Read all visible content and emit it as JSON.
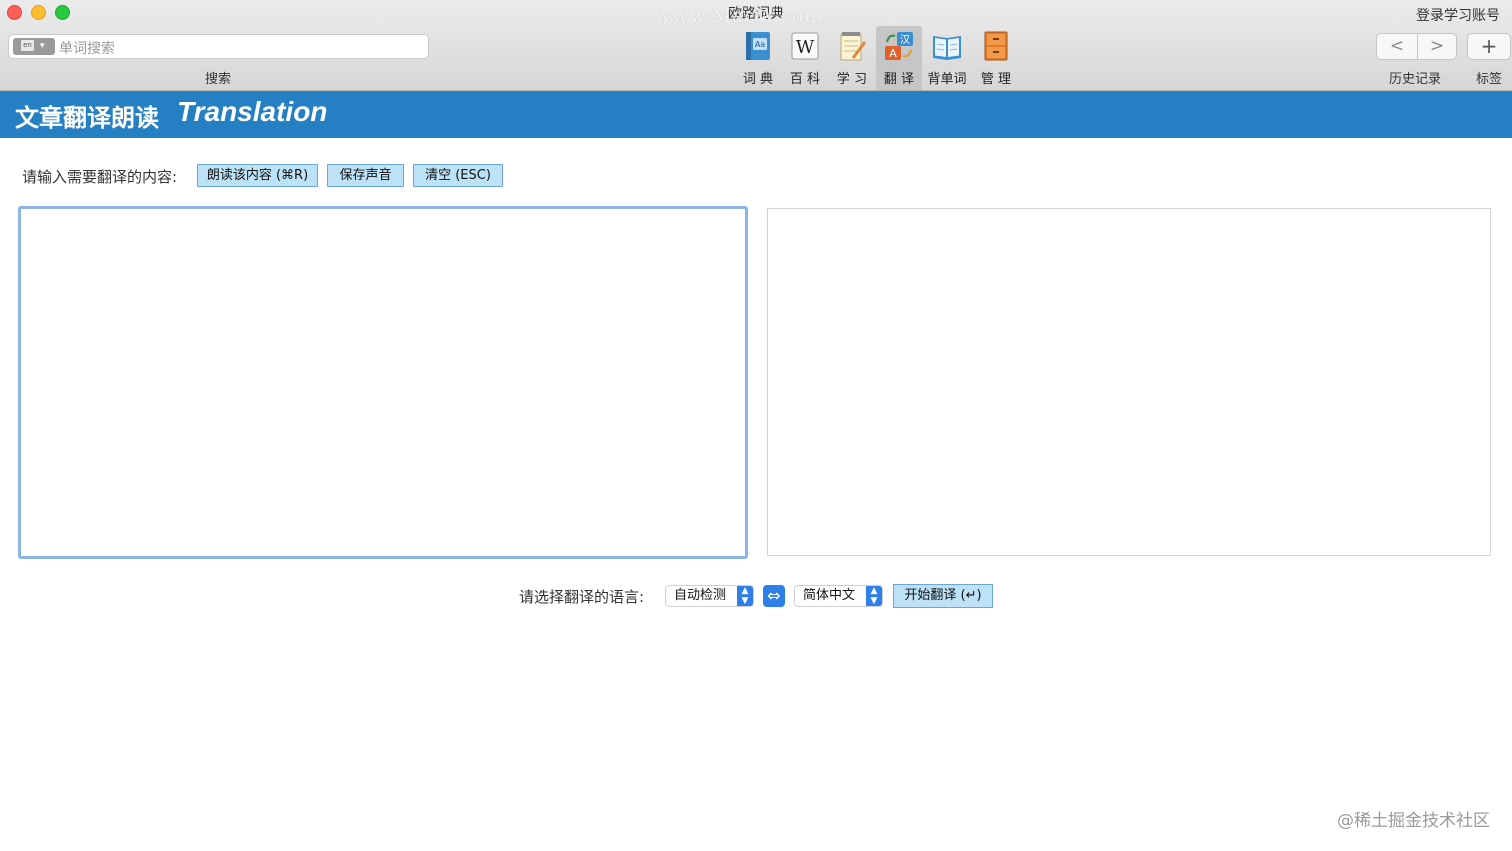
{
  "window": {
    "title": "欧路词典",
    "watermark": "www.MacW.com",
    "login": "登录学习账号"
  },
  "search": {
    "placeholder": "单词搜索",
    "lang_badge": "en",
    "label": "搜索"
  },
  "toolbar": {
    "items": [
      {
        "label": "词 典",
        "icon": "dictionary-icon"
      },
      {
        "label": "百 科",
        "icon": "wikipedia-icon"
      },
      {
        "label": "学 习",
        "icon": "study-notepad-icon"
      },
      {
        "label": "翻 译",
        "icon": "translate-icon",
        "active": true
      },
      {
        "label": "背单词",
        "icon": "vocabulary-book-icon"
      },
      {
        "label": "管 理",
        "icon": "manage-cabinet-icon"
      }
    ],
    "history_label": "历史记录",
    "tags_label": "标签",
    "back_glyph": "<",
    "forward_glyph": ">",
    "add_glyph": "+"
  },
  "banner": {
    "title_cn": "文章翻译朗读",
    "title_en": "Translation",
    "color": "#2580c3"
  },
  "input_section": {
    "prompt": "请输入需要翻译的内容:",
    "read_button": "朗读该内容 (⌘R)",
    "save_button": "保存声音",
    "clear_button": "清空 (ESC)"
  },
  "language": {
    "prompt": "请选择翻译的语言:",
    "source": "自动检测",
    "target": "简体中文",
    "swap_glyph": "⇔",
    "start_button": "开始翻译 (↵)"
  },
  "footer": {
    "watermark": "@稀土掘金技术社区"
  }
}
